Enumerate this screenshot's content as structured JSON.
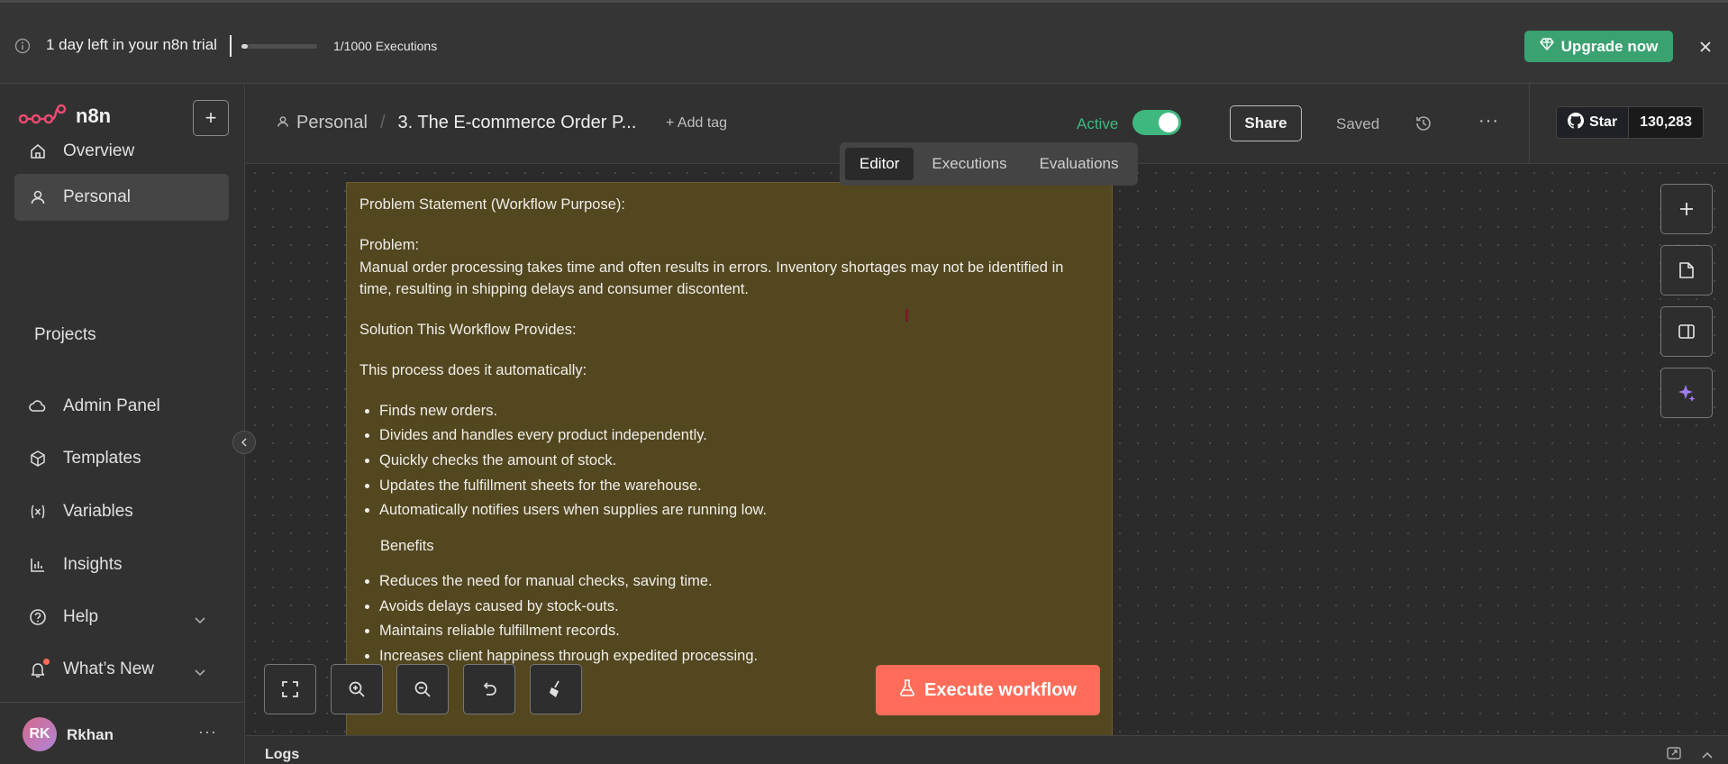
{
  "banner": {
    "trial_text": "1 day left in your n8n trial",
    "executions_text": "1/1000 Executions",
    "executions_used": 1,
    "executions_limit": 1000,
    "upgrade_label": "Upgrade now",
    "upgrade_color": "#3aa170"
  },
  "sidebar": {
    "logo_text": "n8n",
    "items": [
      {
        "label": "Overview",
        "icon": "home-icon"
      },
      {
        "label": "Personal",
        "icon": "user-icon",
        "active": true
      }
    ],
    "projects_title": "Projects",
    "lower_items": [
      {
        "label": "Admin Panel",
        "icon": "cloud-icon"
      },
      {
        "label": "Templates",
        "icon": "box-icon"
      },
      {
        "label": "Variables",
        "icon": "variable-icon"
      },
      {
        "label": "Insights",
        "icon": "chart-icon"
      },
      {
        "label": "Help",
        "icon": "help-icon"
      },
      {
        "label": "What’s New",
        "icon": "bell-icon"
      }
    ],
    "user": {
      "initials": "RK",
      "name": "Rkhan"
    }
  },
  "header": {
    "breadcrumb_project": "Personal",
    "workflow_name": "3. The E-commerce Order P...",
    "add_tag_label": "+ Add tag",
    "active_label": "Active",
    "share_label": "Share",
    "saved_label": "Saved",
    "github_star_label": "Star",
    "github_star_count": "130,283",
    "accent_color": "#3fb87f"
  },
  "tabs": [
    {
      "label": "Editor",
      "selected": true
    },
    {
      "label": "Executions",
      "selected": false
    },
    {
      "label": "Evaluations",
      "selected": false
    }
  ],
  "sticky": {
    "title": "Problem Statement (Workflow Purpose):",
    "problem_heading": "Problem:",
    "problem_text": "Manual order processing takes time and often results in errors. Inventory shortages may not be identified in time, resulting in shipping delays and consumer discontent.",
    "solution_heading": "Solution This Workflow Provides:",
    "process_intro": "This process does it automatically:",
    "steps": [
      "Finds new orders.",
      "Divides and handles every product independently.",
      "Quickly checks the amount of stock.",
      "Updates the fulfillment sheets for the warehouse.",
      "Automatically notifies users when supplies are running low."
    ],
    "benefits_heading": "Benefits",
    "benefits": [
      "Reduces the need for manual checks, saving time.",
      "Avoids delays caused by stock-outs.",
      "Maintains reliable fulfillment records.",
      "Increases client happiness through expedited processing."
    ]
  },
  "canvas": {
    "execute_label": "Execute workflow",
    "execute_color": "#ff6d5a"
  },
  "logs": {
    "label": "Logs"
  }
}
